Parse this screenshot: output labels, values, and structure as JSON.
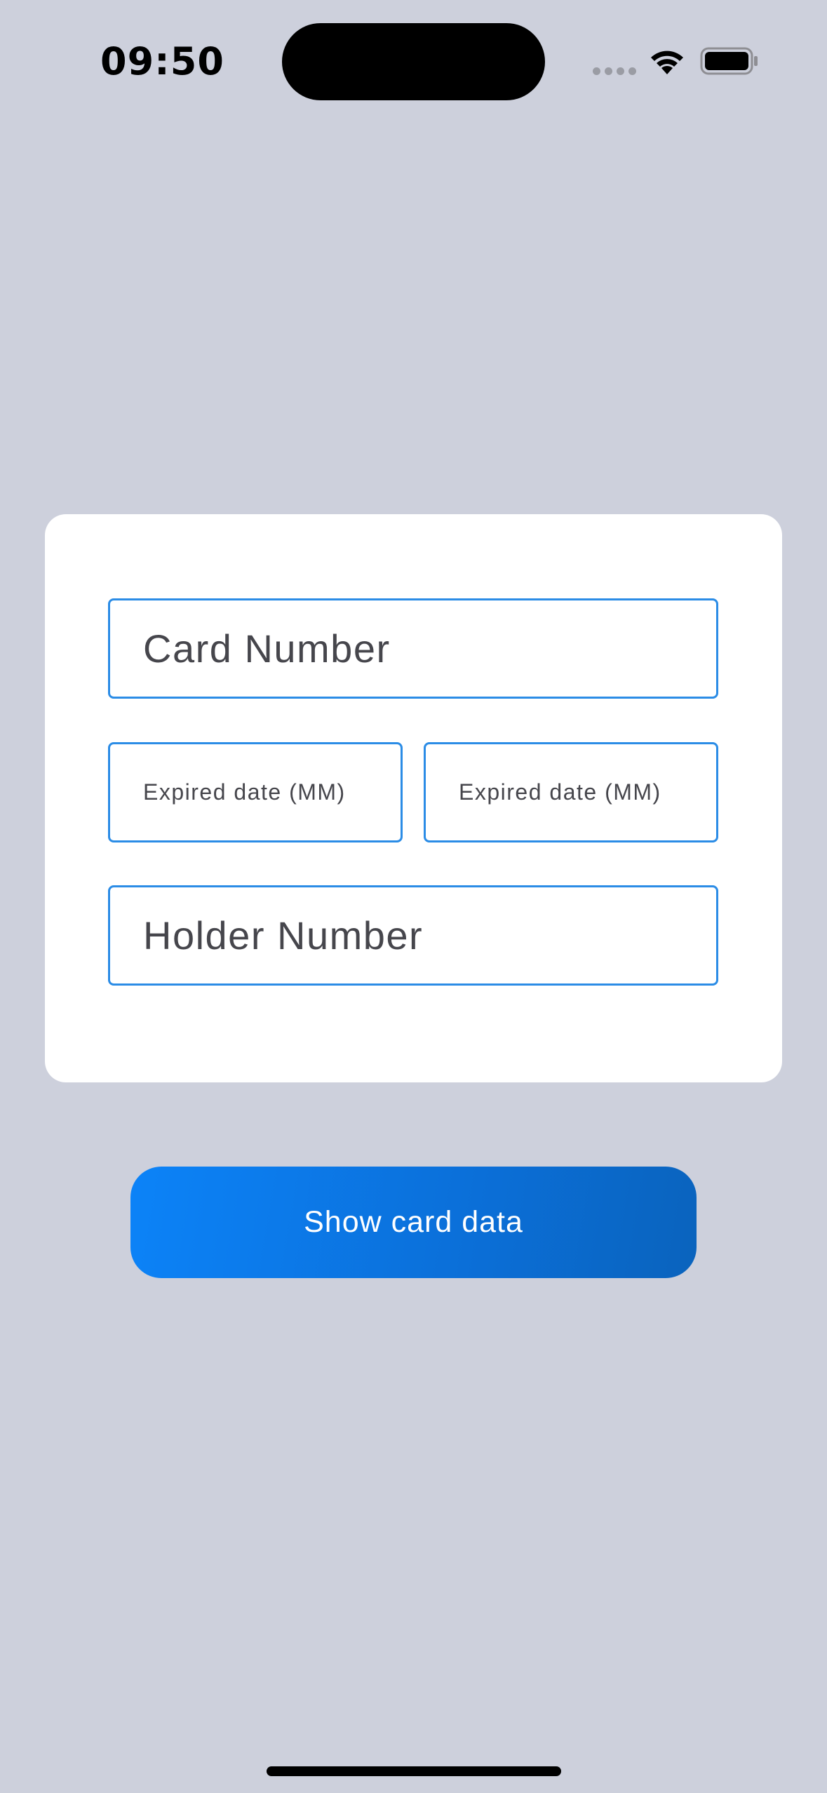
{
  "status_bar": {
    "time": "09:50",
    "icons": [
      "cellular-signal-icon",
      "wifi-icon",
      "battery-icon"
    ]
  },
  "form": {
    "card_number_placeholder": "Card Number",
    "expiry_month_placeholder": "Expired date (MM)",
    "expiry_second_placeholder": "Expired date (MM)",
    "holder_number_placeholder": "Holder Number"
  },
  "actions": {
    "show_button_label": "Show card data"
  },
  "colors": {
    "background": "#cdd0dc",
    "card": "#ffffff",
    "field_border": "#2b8ce6",
    "button_start": "#0c83f8",
    "button_end": "#0a63bd"
  }
}
